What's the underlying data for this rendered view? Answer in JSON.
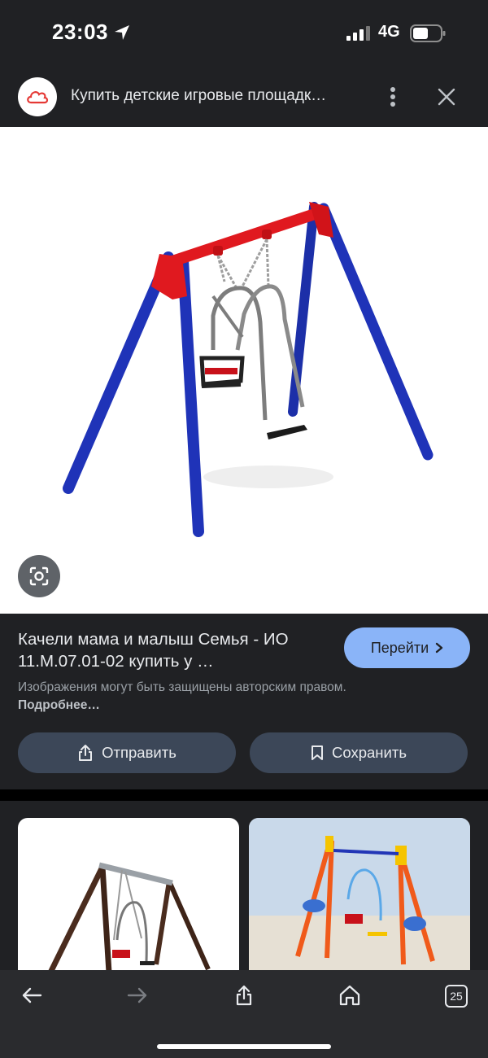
{
  "status": {
    "time": "23:03",
    "network": "4G"
  },
  "header": {
    "title": "Купить детские игровые площадк…"
  },
  "result": {
    "title": "Качели мама и малыш Семья - ИО 11.М.07.01-02 купить у …",
    "go_label": "Перейти",
    "copyright_text": "Изображения могут быть защищены авторским правом.",
    "copyright_link": "Подробнее…"
  },
  "actions": {
    "share_label": "Отправить",
    "save_label": "Сохранить"
  },
  "tabs": {
    "count": "25"
  },
  "colors": {
    "background": "#202124",
    "accent": "#8ab4f8",
    "button_bg": "#3c4758",
    "frame_red": "#e0191f",
    "frame_blue": "#1f2fb0"
  },
  "icons": {
    "location": "location-arrow-icon",
    "logo": "cloud-logo-icon",
    "more": "more-vert-icon",
    "close": "close-icon",
    "lens": "lens-icon",
    "share": "share-icon",
    "save": "bookmark-icon",
    "back": "arrow-back-icon",
    "forward": "arrow-forward-icon",
    "home": "home-icon"
  }
}
